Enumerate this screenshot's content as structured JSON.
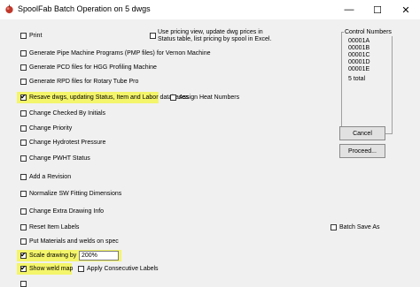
{
  "window": {
    "title": "SpoolFab Batch Operation on 5 dwgs",
    "minimize_glyph": "—",
    "maximize_glyph": "☐",
    "close_glyph": "✕",
    "app_icon": "spoolfab-app-icon"
  },
  "options": {
    "print": "Print",
    "pricing_line1": "Use pricing view, update dwg prices in",
    "pricing_line2": "Status table, list pricing by spool in Excel.",
    "pmp": "Generate Pipe Machine Programs (PMP files)  for Vernon Machine",
    "pcd": "Generate PCD files for HGG Profiling Machine",
    "rpd": "Generate RPD files for Rotary Tube Pro",
    "resave": "Resave dwgs, updating Status, Item and Labor databases",
    "assign_heat": "Assign Heat Numbers",
    "checked_by": "Change Checked By Initials",
    "priority": "Change Priority",
    "hydrotest": "Change Hydrotest Pressure",
    "pwht": "Change PWHT Status",
    "revision": "Add a Revision",
    "normalize": "Normalize SW Fitting Dimensions",
    "extra_drawing": "Change Extra Drawing Info",
    "reset_labels": "Reset Item Labels",
    "batch_save_as": "Batch Save As",
    "put_materials": "Put Materials and welds on spec",
    "scale": "Scale drawing by",
    "scale_value": "200%",
    "weld_map": "Show weld map",
    "consecutive": "Apply Consecutive Labels"
  },
  "control_numbers": {
    "title": "Control Numbers",
    "items": [
      "00001A",
      "00001B",
      "00001C",
      "00001D",
      "00001E"
    ],
    "total": "5 total"
  },
  "buttons": {
    "cancel": "Cancel",
    "proceed": "Proceed..."
  },
  "colors": {
    "highlight": "#f4f56a"
  }
}
